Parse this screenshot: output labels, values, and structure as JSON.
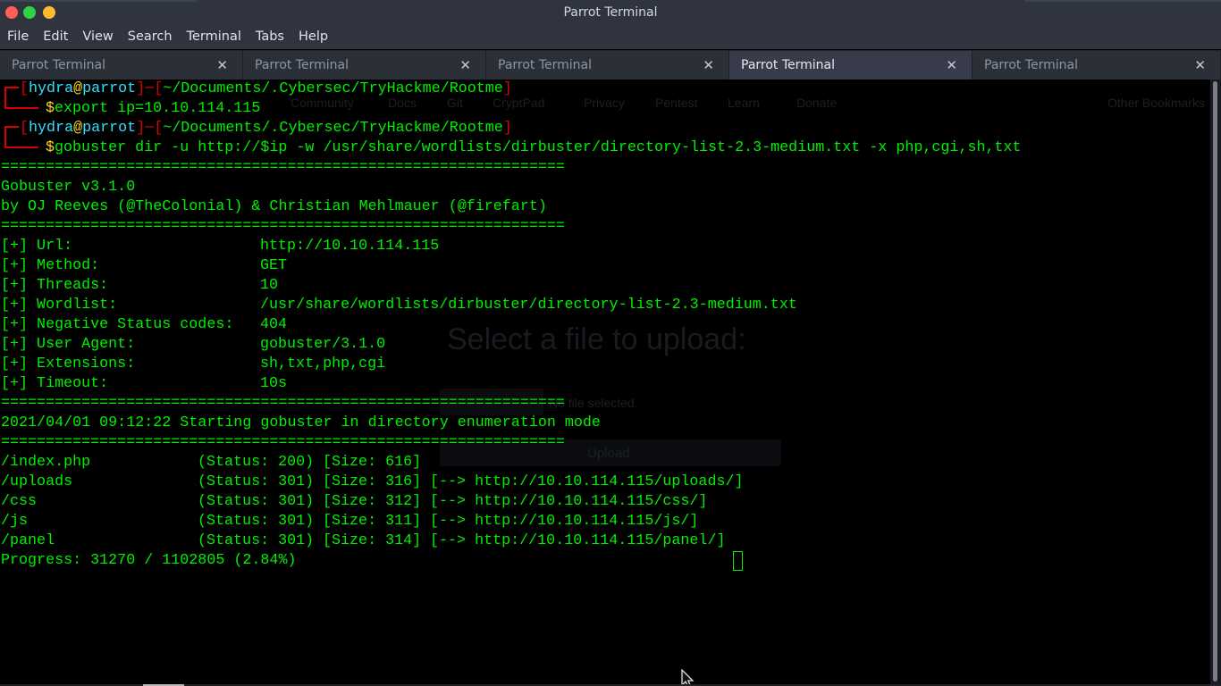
{
  "window": {
    "title": "Parrot Terminal"
  },
  "menu": [
    "File",
    "Edit",
    "View",
    "Search",
    "Terminal",
    "Tabs",
    "Help"
  ],
  "tabs": [
    {
      "label": "Parrot Terminal",
      "active": false
    },
    {
      "label": "Parrot Terminal",
      "active": false
    },
    {
      "label": "Parrot Terminal",
      "active": false
    },
    {
      "label": "Parrot Terminal",
      "active": true
    },
    {
      "label": "Parrot Terminal",
      "active": false
    }
  ],
  "tab_close_glyph": "✕",
  "prompt": {
    "user": "hydra",
    "at": "@",
    "host": "parrot",
    "path": "~/Documents/.Cybersec/TryHackme/Rootme",
    "symbol": "$"
  },
  "commands": [
    "export ip=10.10.114.115",
    "gobuster dir -u http://$ip -w /usr/share/wordlists/dirbuster/directory-list-2.3-medium.txt -x php,cgi,sh,txt"
  ],
  "separator": "===============================================================",
  "banner": {
    "version": "Gobuster v3.1.0",
    "authors": "by OJ Reeves (@TheColonial) & Christian Mehlmauer (@firefart)"
  },
  "config": [
    {
      "key": "[+] Url:",
      "value": "http://10.10.114.115"
    },
    {
      "key": "[+] Method:",
      "value": "GET"
    },
    {
      "key": "[+] Threads:",
      "value": "10"
    },
    {
      "key": "[+] Wordlist:",
      "value": "/usr/share/wordlists/dirbuster/directory-list-2.3-medium.txt"
    },
    {
      "key": "[+] Negative Status codes:",
      "value": "404"
    },
    {
      "key": "[+] User Agent:",
      "value": "gobuster/3.1.0"
    },
    {
      "key": "[+] Extensions:",
      "value": "sh,txt,php,cgi"
    },
    {
      "key": "[+] Timeout:",
      "value": "10s"
    }
  ],
  "start_message": "2021/04/01 09:12:22 Starting gobuster in directory enumeration mode",
  "results": [
    {
      "path": "/index.php",
      "status": "(Status: 200)",
      "size": "[Size: 616]",
      "redirect": ""
    },
    {
      "path": "/uploads",
      "status": "(Status: 301)",
      "size": "[Size: 316]",
      "redirect": "[--> http://10.10.114.115/uploads/]"
    },
    {
      "path": "/css",
      "status": "(Status: 301)",
      "size": "[Size: 312]",
      "redirect": "[--> http://10.10.114.115/css/]"
    },
    {
      "path": "/js",
      "status": "(Status: 301)",
      "size": "[Size: 311]",
      "redirect": "[--> http://10.10.114.115/js/]"
    },
    {
      "path": "/panel",
      "status": "(Status: 301)",
      "size": "[Size: 314]",
      "redirect": "[--> http://10.10.114.115/panel/]"
    }
  ],
  "progress": "Progress: 31270 / 1102805 (2.84%)",
  "background_ghost": {
    "bookmarks": [
      "Community",
      "Docs",
      "Git",
      "CryptPad",
      "Privacy",
      "Pentest",
      "Learn",
      "Donate",
      "Other Bookmarks"
    ],
    "upload_title": "Select a file to upload:",
    "no_file": "No file selected.",
    "upload_button": "Upload"
  }
}
